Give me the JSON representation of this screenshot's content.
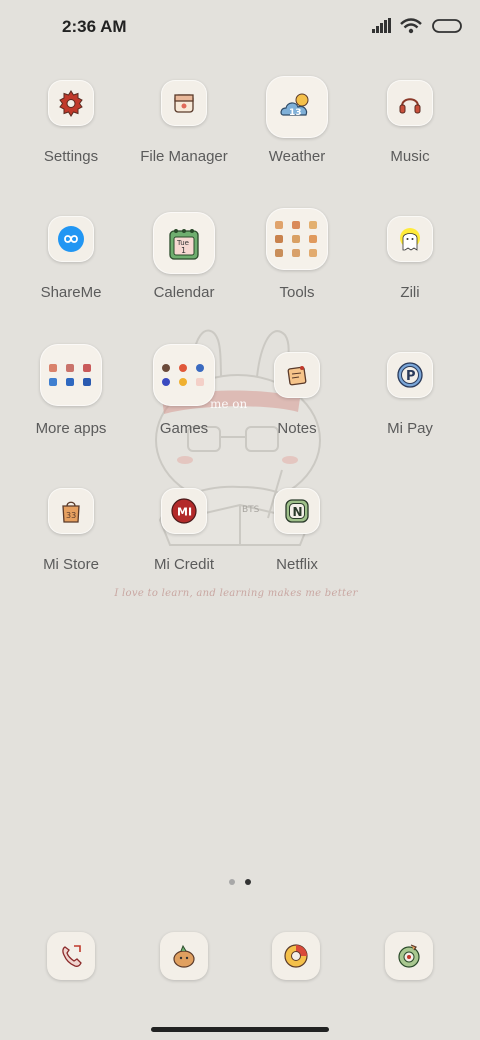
{
  "status_bar": {
    "time": "2:36 AM"
  },
  "wallpaper": {
    "banner_text": "me  on",
    "book_text": "BTS",
    "caption": "I love to learn, and learning makes me better"
  },
  "apps": [
    {
      "label": "Settings",
      "icon": "gear-icon"
    },
    {
      "label": "File Manager",
      "icon": "folder-icon"
    },
    {
      "label": "Weather",
      "icon": "weather-icon",
      "badge": "13"
    },
    {
      "label": "Music",
      "icon": "headphones-icon"
    },
    {
      "label": "ShareMe",
      "icon": "infinity-icon"
    },
    {
      "label": "Calendar",
      "icon": "calendar-icon",
      "day": "Tue",
      "date": "1"
    },
    {
      "label": "Tools",
      "icon": "folder-grid-icon"
    },
    {
      "label": "Zili",
      "icon": "ghost-icon"
    },
    {
      "label": "More apps",
      "icon": "folder-grid-icon"
    },
    {
      "label": "Games",
      "icon": "folder-grid-icon"
    },
    {
      "label": "Notes",
      "icon": "note-icon"
    },
    {
      "label": "Mi Pay",
      "icon": "mipay-icon",
      "letter": "P"
    },
    {
      "label": "Mi Store",
      "icon": "shopping-bag-icon",
      "badge": "33"
    },
    {
      "label": "Mi Credit",
      "icon": "mi-credit-icon",
      "letter": "MI"
    },
    {
      "label": "Netflix",
      "icon": "netflix-icon",
      "letter": "N"
    }
  ],
  "dock": [
    {
      "icon": "phone-icon"
    },
    {
      "icon": "messages-icon"
    },
    {
      "icon": "browser-icon"
    },
    {
      "icon": "camera-icon"
    }
  ],
  "page_indicator": {
    "pages": 2,
    "current": 2
  },
  "colors": {
    "background": "#e3e1dc",
    "icon_tile": "#f3efe8",
    "label": "#5b5b5b",
    "accent_red": "#c0392b",
    "accent_blue": "#2f6fb5"
  }
}
